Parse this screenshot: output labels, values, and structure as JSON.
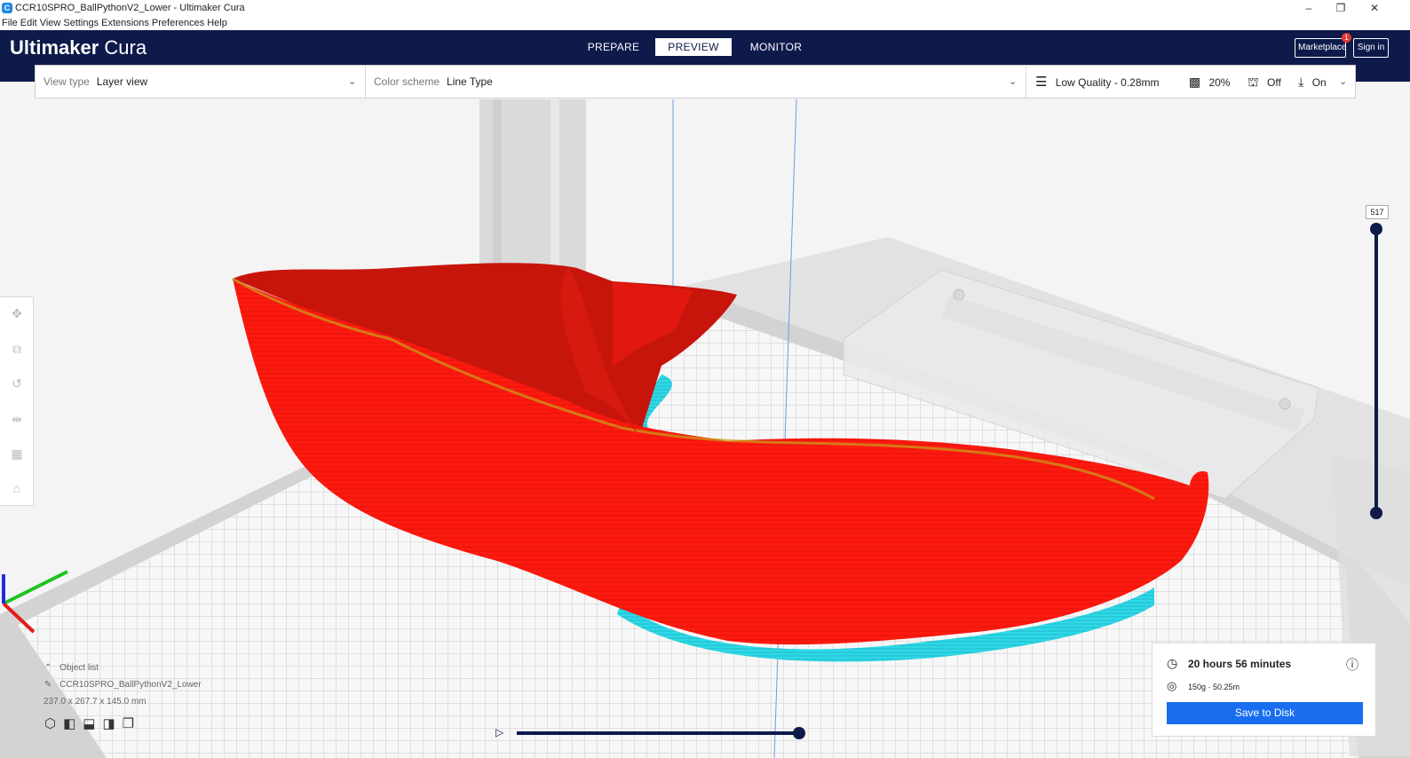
{
  "window": {
    "title": "CCR10SPRO_BallPythonV2_Lower - Ultimaker Cura",
    "app_icon": "cura-icon",
    "controls": {
      "minimize": "–",
      "restore": "❐",
      "close": "✕"
    }
  },
  "menubar": [
    "File",
    "Edit",
    "View",
    "Settings",
    "Extensions",
    "Preferences",
    "Help"
  ],
  "header": {
    "logo_bold": "Ultimaker",
    "logo_light": " Cura",
    "stages": [
      {
        "label": "PREPARE",
        "active": false
      },
      {
        "label": "PREVIEW",
        "active": true
      },
      {
        "label": "MONITOR",
        "active": false
      }
    ],
    "marketplace_label": "Marketplace",
    "marketplace_badge": "1",
    "signin_label": "Sign in"
  },
  "toolbar": {
    "view_type_label": "View type",
    "view_type_value": "Layer view",
    "color_scheme_label": "Color scheme",
    "color_scheme_value": "Line Type",
    "profile": "Low Quality - 0.28mm",
    "infill": "20%",
    "support": "Off",
    "adhesion": "On"
  },
  "layer_slider": {
    "max_layer": "517",
    "upper_fraction": 1.0,
    "lower_fraction": 0.0
  },
  "path_slider": {
    "position_fraction": 1.0
  },
  "object_list": {
    "header": "Object list",
    "object_name": "CCR10SPRO_BallPythonV2_Lower",
    "dimensions": "237.0 x 267.7 x 145.0 mm"
  },
  "print_info": {
    "time": "20 hours 56 minutes",
    "material": "150g · 50.25m",
    "save_label": "Save to Disk"
  },
  "colors": {
    "header_bg": "#0d1a4a",
    "accent": "#196ef0",
    "model_wall": "#ff1a10",
    "skirt": "#2fd8e6",
    "axis_x": "#e31c1c",
    "axis_y": "#21c221",
    "axis_z": "#1f2be6"
  },
  "icons": [
    "move-icon",
    "scale-icon",
    "rotate-icon",
    "mirror-icon",
    "per-model-settings-icon",
    "support-blocker-icon",
    "clock-icon",
    "material-spool-icon",
    "info-icon",
    "edit-icon",
    "play-icon",
    "settings-sliders-icon",
    "infill-icon",
    "support-icon",
    "adhesion-icon"
  ]
}
